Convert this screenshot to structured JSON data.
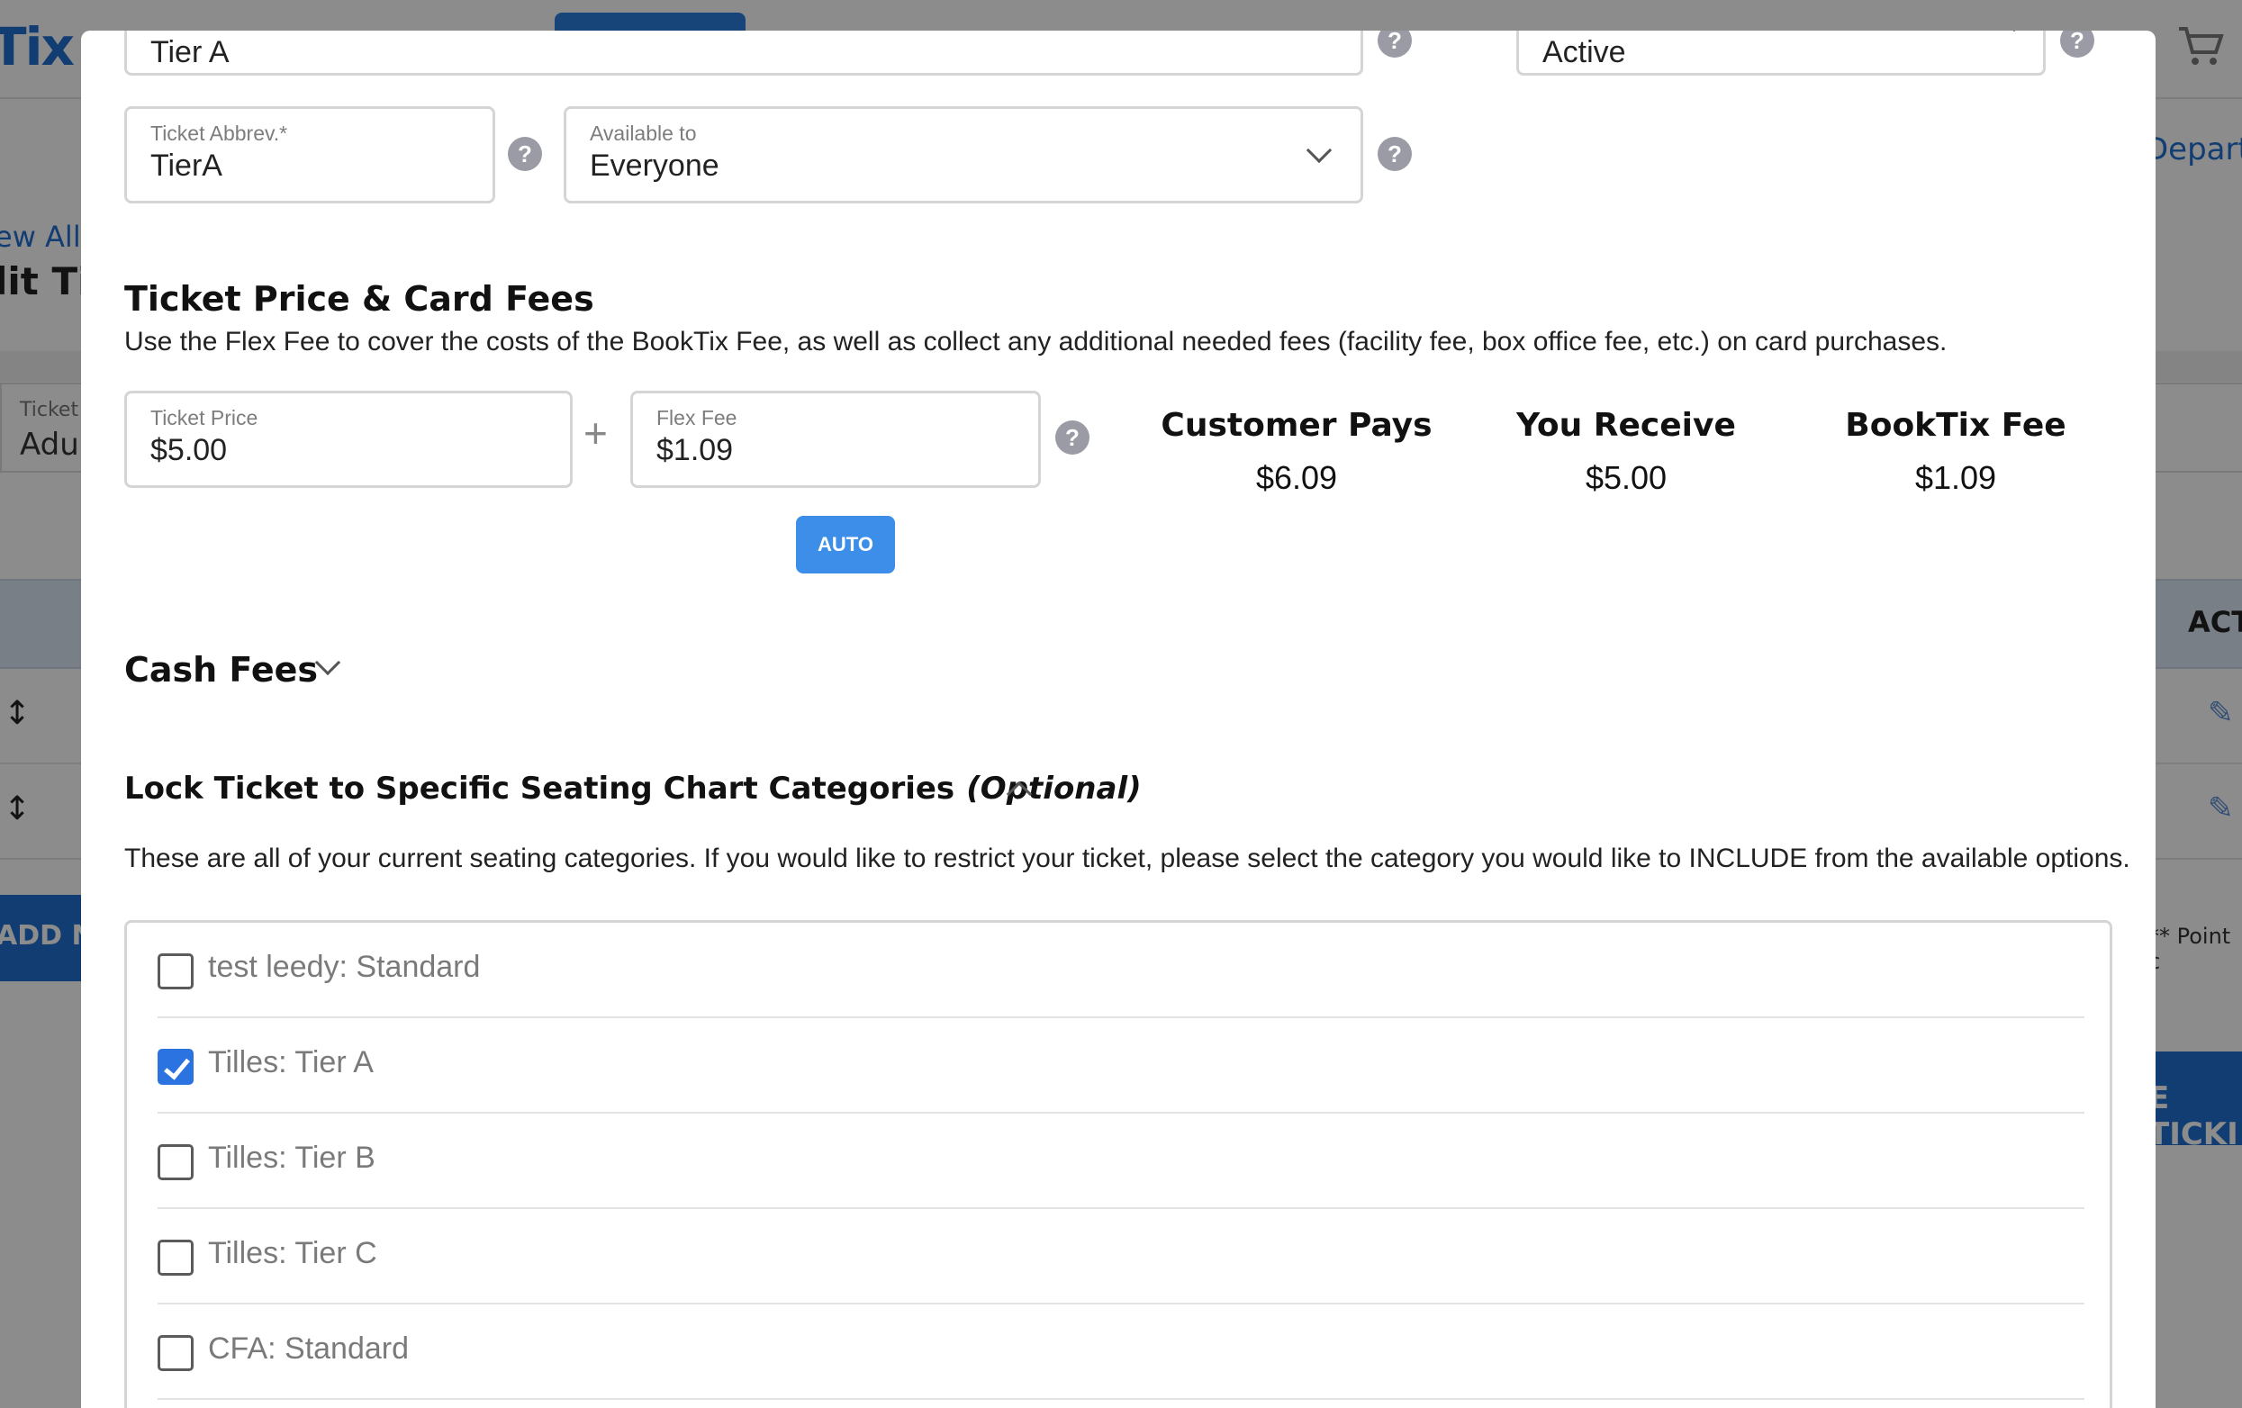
{
  "background": {
    "logo": "Tix",
    "depart_link": "Depart",
    "view_all": "ew All",
    "edit_title": "lit Tic",
    "ticket_label": "Ticket",
    "ticket_value": "Adul",
    "actions_header": "ACT",
    "add_button": "ADD NI",
    "point_note": "** Point c",
    "ticket_button": "E TICKI"
  },
  "modal": {
    "top_row": {
      "name_value": "Tier A",
      "status_value": "Active"
    },
    "abbrev": {
      "label": "Ticket Abbrev.*",
      "value": "TierA"
    },
    "available": {
      "label": "Available to",
      "value": "Everyone"
    },
    "price_section": {
      "title": "Ticket Price & Card Fees",
      "description": "Use the Flex Fee to cover the costs of the BookTix Fee, as well as collect any additional needed fees (facility fee, box office fee, etc.) on card purchases.",
      "ticket_price": {
        "label": "Ticket Price",
        "value": "$5.00"
      },
      "plus": "+",
      "flex_fee": {
        "label": "Flex Fee",
        "value": "$1.09"
      },
      "auto_label": "AUTO",
      "customer_pays": {
        "label": "Customer Pays",
        "value": "$6.09"
      },
      "you_receive": {
        "label": "You Receive",
        "value": "$5.00"
      },
      "booktix_fee": {
        "label": "BookTix Fee",
        "value": "$1.09"
      }
    },
    "cash_fees": {
      "title": "Cash Fees"
    },
    "lock_section": {
      "title": "Lock Ticket to Specific Seating Chart Categories",
      "optional": "(Optional)",
      "description": "These are all of your current seating categories. If you would like to restrict your ticket, please select the category you would like to INCLUDE from the available options.",
      "categories": [
        {
          "label": "test leedy: Standard",
          "checked": false
        },
        {
          "label": "Tilles: Tier A",
          "checked": true
        },
        {
          "label": "Tilles: Tier B",
          "checked": false
        },
        {
          "label": "Tilles: Tier C",
          "checked": false
        },
        {
          "label": "CFA: Standard",
          "checked": false
        }
      ]
    },
    "help_icon": "?"
  }
}
